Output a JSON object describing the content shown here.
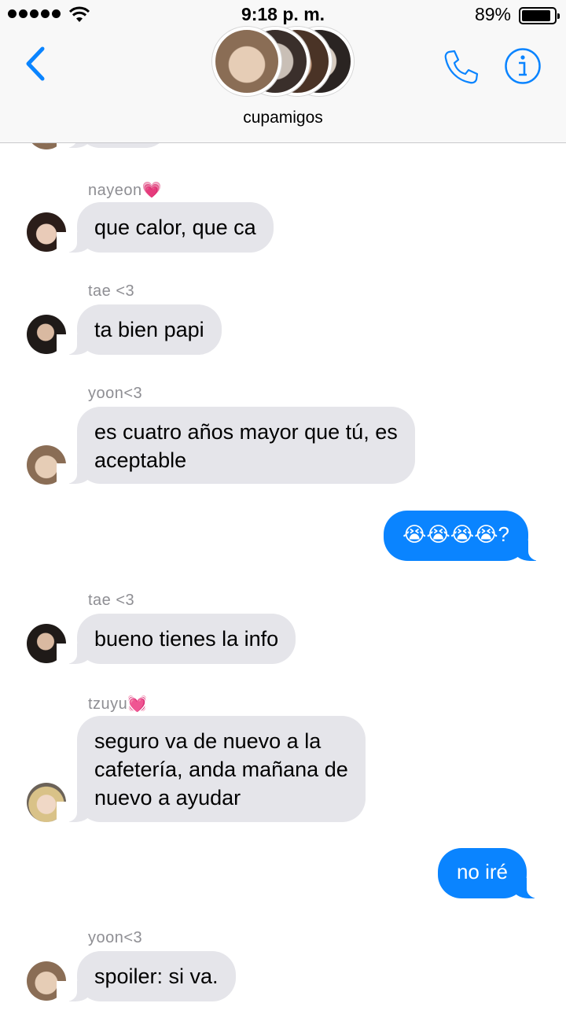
{
  "status_bar": {
    "time": "9:18 p. m.",
    "battery": "89%",
    "battery_level": 0.89
  },
  "header": {
    "back_icon": "chevron-left-icon",
    "group_name": "cupamigos",
    "call_icon": "phone-icon",
    "info_icon": "info-icon",
    "accent_color": "#0a84ff"
  },
  "messages": [
    {
      "sender": "nayeon",
      "sender_emoji": "💗",
      "text": "que calor, que ca",
      "direction": "in"
    },
    {
      "sender": "tae <3",
      "text": "ta bien papi",
      "direction": "in"
    },
    {
      "sender": "yoon<3",
      "line1": "es cuatro años mayor que tú, es",
      "line2": "aceptable",
      "direction": "in"
    },
    {
      "text": "😭😭😭😭?",
      "direction": "out"
    },
    {
      "sender": "tae <3",
      "text": "bueno tienes la info",
      "direction": "in"
    },
    {
      "sender": "tzuyu",
      "sender_emoji": "💓",
      "line1": "seguro va de nuevo a la",
      "line2": "cafetería, anda mañana de",
      "line3": "nuevo a ayudar",
      "direction": "in"
    },
    {
      "text": "no iré",
      "direction": "out"
    },
    {
      "sender": "yoon<3",
      "text": "spoiler: si va.",
      "direction": "in"
    }
  ]
}
